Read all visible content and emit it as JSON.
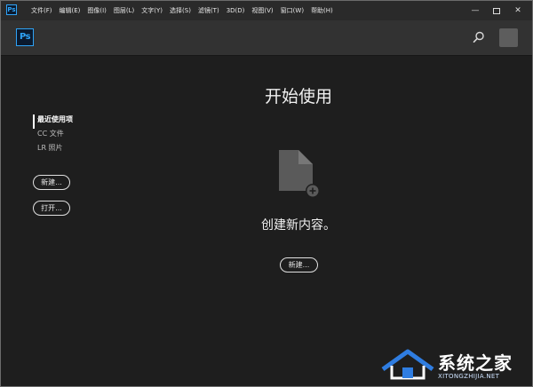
{
  "app": {
    "logo_small": "Ps",
    "logo": "Ps"
  },
  "menu": {
    "items": [
      "文件(F)",
      "编辑(E)",
      "图像(I)",
      "图层(L)",
      "文字(Y)",
      "选择(S)",
      "滤镜(T)",
      "3D(D)",
      "视图(V)",
      "窗口(W)",
      "帮助(H)"
    ]
  },
  "window_controls": {
    "minimize": "—",
    "close": "✕"
  },
  "header": {
    "search_icon": "search-icon",
    "profile_icon": "profile-icon"
  },
  "sidebar": {
    "items": [
      "最近使用项",
      "CC 文件",
      "LR 照片"
    ],
    "new_label": "新建...",
    "open_label": "打开..."
  },
  "main": {
    "title": "开始使用",
    "create_text": "创建新内容。",
    "new_label": "新建..."
  },
  "watermark": {
    "text": "系统之家",
    "url": "XITONGZHIJIA.NET"
  },
  "colors": {
    "accent": "#2fa3f6",
    "background": "#1e1e1e",
    "header": "#323232"
  }
}
